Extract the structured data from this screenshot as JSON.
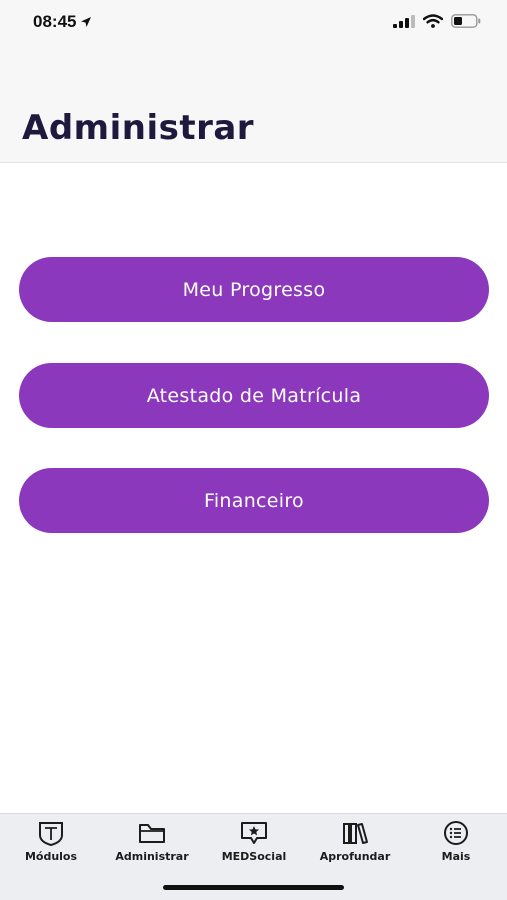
{
  "status_bar": {
    "time": "08:45",
    "icons": [
      "location-arrow-icon",
      "cellular-signal-icon",
      "wifi-icon",
      "battery-icon"
    ]
  },
  "header": {
    "title": "Administrar"
  },
  "menu": {
    "items": [
      {
        "label": "Meu Progresso"
      },
      {
        "label": "Atestado de Matrícula"
      },
      {
        "label": "Financeiro"
      }
    ]
  },
  "colors": {
    "accent": "#8b38bd",
    "title": "#1f1a3d",
    "header_bg": "#f7f7f7",
    "tabbar_bg": "#eceef2"
  },
  "tab_bar": {
    "tabs": [
      {
        "label": "Módulos",
        "icon": "shield-book-icon"
      },
      {
        "label": "Administrar",
        "icon": "folder-icon"
      },
      {
        "label": "MEDSocial",
        "icon": "chat-star-icon"
      },
      {
        "label": "Aprofundar",
        "icon": "books-icon"
      },
      {
        "label": "Mais",
        "icon": "list-circle-icon"
      }
    ]
  }
}
